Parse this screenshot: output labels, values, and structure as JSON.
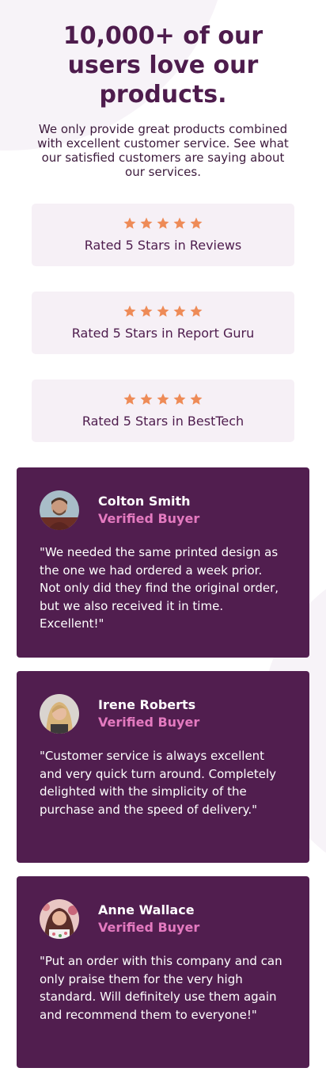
{
  "header": {
    "title": "10,000+ of our users love our products.",
    "description": "We only provide great products combined with excellent customer service. See what our satisfied customers are saying about our services."
  },
  "ratings": [
    {
      "stars": 5,
      "label": "Rated 5 Stars in Reviews"
    },
    {
      "stars": 5,
      "label": "Rated 5 Stars in Report Guru"
    },
    {
      "stars": 5,
      "label": "Rated 5 Stars in BestTech"
    }
  ],
  "testimonials": [
    {
      "name": "Colton Smith",
      "status": "Verified Buyer",
      "quote": "\"We needed the same printed design as the one we had ordered a week prior. Not only did they find the original order, but we also received it in time. Excellent!\""
    },
    {
      "name": "Irene Roberts",
      "status": "Verified Buyer",
      "quote": "\"Customer service is always excellent and very quick turn around. Completely delighted with the simplicity of the purchase and the speed of delivery.\""
    },
    {
      "name": "Anne Wallace",
      "status": "Verified Buyer",
      "quote": "\"Put an order with this company and can only praise them for the very high standard. Will definitely use them again and recommend them to everyone!\""
    }
  ],
  "colors": {
    "accent": "#ee8b57",
    "primary": "#4e1c4d",
    "card": "#511e4f",
    "highlight": "#e47ac0"
  },
  "icons": {
    "rating": "star-icon"
  }
}
